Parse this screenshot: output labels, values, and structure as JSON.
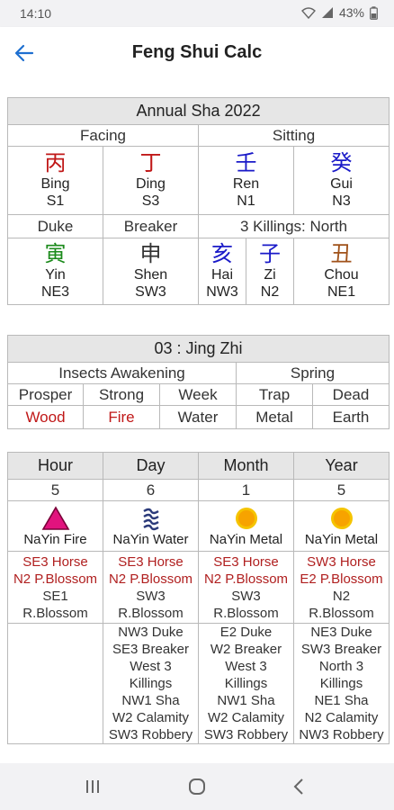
{
  "status": {
    "time": "14:10",
    "battery": "43%"
  },
  "appbar": {
    "title": "Feng Shui Calc"
  },
  "annual": {
    "title": "Annual Sha 2022",
    "facing_label": "Facing",
    "sitting_label": "Sitting",
    "mountains": [
      {
        "char": "丙",
        "pinyin": "Bing",
        "code": "S1",
        "color": "#c01818"
      },
      {
        "char": "丁",
        "pinyin": "Ding",
        "code": "S3",
        "color": "#c01818"
      },
      {
        "char": "壬",
        "pinyin": "Ren",
        "code": "N1",
        "color": "#1a1ac8"
      },
      {
        "char": "癸",
        "pinyin": "Gui",
        "code": "N3",
        "color": "#1a1ac8"
      }
    ],
    "duke_label": "Duke",
    "breaker_label": "Breaker",
    "killings_label": "3 Killings: North",
    "branches": [
      {
        "char": "寅",
        "pinyin": "Yin",
        "code": "NE3",
        "color": "#1b8a1b"
      },
      {
        "char": "申",
        "pinyin": "Shen",
        "code": "SW3",
        "color": "#333333"
      },
      {
        "char": "亥",
        "pinyin": "Hai",
        "code": "NW3",
        "color": "#1a1ac8"
      },
      {
        "char": "子",
        "pinyin": "Zi",
        "code": "N2",
        "color": "#1a1ac8"
      },
      {
        "char": "丑",
        "pinyin": "Chou",
        "code": "NE1",
        "color": "#a0521a"
      }
    ]
  },
  "solar": {
    "title": "03 : Jing Zhi",
    "term": "Insects Awakening",
    "season": "Spring",
    "states": [
      "Prosper",
      "Strong",
      "Week",
      "Trap",
      "Dead"
    ],
    "elements": [
      {
        "name": "Wood",
        "color": "#c01818"
      },
      {
        "name": "Fire",
        "color": "#c01818"
      },
      {
        "name": "Water",
        "color": "#333333"
      },
      {
        "name": "Metal",
        "color": "#333333"
      },
      {
        "name": "Earth",
        "color": "#333333"
      }
    ]
  },
  "pillars": {
    "headers": [
      "Hour",
      "Day",
      "Month",
      "Year"
    ],
    "numbers": [
      "5",
      "6",
      "1",
      "5"
    ],
    "icons": [
      "fire-triangle-icon",
      "water-wave-icon",
      "metal-sun-icon",
      "metal-sun-icon"
    ],
    "nayin": [
      "NaYin Fire",
      "NaYin Water",
      "NaYin Metal",
      "NaYin Metal"
    ],
    "red_lines": [
      [
        "SE3 Horse",
        "N2 P.Blossom"
      ],
      [
        "SE3 Horse",
        "N2 P.Blossom"
      ],
      [
        "SE3 Horse",
        "N2 P.Blossom"
      ],
      [
        "SW3 Horse",
        "E2 P.Blossom"
      ]
    ],
    "blossom": [
      [
        "SE1",
        "R.Blossom"
      ],
      [
        "SW3",
        "R.Blossom"
      ],
      [
        "SW3",
        "R.Blossom"
      ],
      [
        "N2",
        "R.Blossom"
      ]
    ],
    "sha": [
      [],
      [
        "NW3 Duke",
        "SE3 Breaker",
        "West 3",
        "Killings",
        "NW1 Sha",
        "W2 Calamity",
        "SW3 Robbery"
      ],
      [
        "E2 Duke",
        "W2 Breaker",
        "West 3",
        "Killings",
        "NW1 Sha",
        "W2 Calamity",
        "SW3 Robbery"
      ],
      [
        "NE3 Duke",
        "SW3 Breaker",
        "North 3",
        "Killings",
        "NE1 Sha",
        "N2 Calamity",
        "NW3 Robbery"
      ]
    ]
  }
}
